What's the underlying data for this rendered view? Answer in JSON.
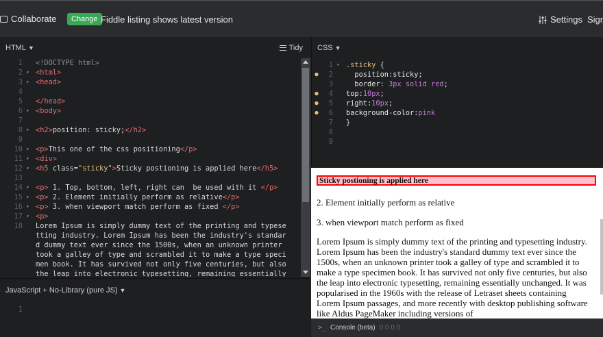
{
  "topbar": {
    "collaborate_label": "Collaborate",
    "change_label": "Change",
    "fiddle_message": "Fiddle listing shows latest version",
    "settings_label": "Settings",
    "sign_label": "Sign"
  },
  "html_panel": {
    "title": "HTML",
    "tidy_label": "Tidy",
    "lines": [
      {
        "n": "1",
        "fold": "",
        "segs": [
          [
            "comment",
            "<!DOCTYPE html>"
          ]
        ]
      },
      {
        "n": "2",
        "fold": "▾",
        "segs": [
          [
            "tag",
            "<html>"
          ]
        ]
      },
      {
        "n": "3",
        "fold": "▾",
        "segs": [
          [
            "tag",
            "<head>"
          ]
        ]
      },
      {
        "n": "4",
        "fold": "",
        "segs": []
      },
      {
        "n": "5",
        "fold": "",
        "segs": [
          [
            "tag",
            "</head>"
          ]
        ]
      },
      {
        "n": "6",
        "fold": "▾",
        "segs": [
          [
            "tag",
            "<body>"
          ]
        ]
      },
      {
        "n": "7",
        "fold": "",
        "segs": []
      },
      {
        "n": "8",
        "fold": "▾",
        "segs": [
          [
            "tag",
            "<h2>"
          ],
          [
            "txt",
            "position: sticky;"
          ],
          [
            "tag",
            "</h2>"
          ]
        ]
      },
      {
        "n": "9",
        "fold": "",
        "segs": []
      },
      {
        "n": "10",
        "fold": "▾",
        "segs": [
          [
            "tag",
            "<p>"
          ],
          [
            "txt",
            "This one of the css positioning"
          ],
          [
            "tag",
            "</p>"
          ]
        ]
      },
      {
        "n": "11",
        "fold": "▾",
        "segs": [
          [
            "tag",
            "<div>"
          ]
        ]
      },
      {
        "n": "12",
        "fold": "▾",
        "segs": [
          [
            "tag",
            "<h5 "
          ],
          [
            "attr",
            "class="
          ],
          [
            "str",
            "\"sticky\""
          ],
          [
            "tag",
            ">"
          ],
          [
            "txt",
            "Sticky postioning is applied here"
          ],
          [
            "tag",
            "</h5>"
          ]
        ]
      },
      {
        "n": "13",
        "fold": "",
        "segs": []
      },
      {
        "n": "14",
        "fold": "▾",
        "segs": [
          [
            "tag",
            "<p>"
          ],
          [
            "txt",
            " 1. Top, bottom, left, right can  be used with it "
          ],
          [
            "tag",
            "</p>"
          ]
        ]
      },
      {
        "n": "15",
        "fold": "▾",
        "segs": [
          [
            "tag",
            "<p>"
          ],
          [
            "txt",
            " 2. Element initially perform as relative"
          ],
          [
            "tag",
            "</p>"
          ]
        ]
      },
      {
        "n": "16",
        "fold": "▾",
        "segs": [
          [
            "tag",
            "<p>"
          ],
          [
            "txt",
            " 3. when viewport match perform as fixed "
          ],
          [
            "tag",
            "</p>"
          ]
        ]
      },
      {
        "n": "17",
        "fold": "▾",
        "segs": [
          [
            "tag",
            "<p>"
          ]
        ]
      },
      {
        "n": "18",
        "fold": "",
        "segs": [
          [
            "txt",
            "Lorem Ipsum is simply dummy text of the printing and typese"
          ]
        ]
      },
      {
        "n": "",
        "fold": "",
        "segs": [
          [
            "txt",
            "tting industry. Lorem Ipsum has been the industry's standar"
          ]
        ]
      },
      {
        "n": "",
        "fold": "",
        "segs": [
          [
            "txt",
            "d dummy text ever since the 1500s, when an unknown printer"
          ]
        ]
      },
      {
        "n": "",
        "fold": "",
        "segs": [
          [
            "txt",
            "took a galley of type and scrambled it to make a type speci"
          ]
        ]
      },
      {
        "n": "",
        "fold": "",
        "segs": [
          [
            "txt",
            "men book. It has survived not only five centuries, but also"
          ]
        ]
      },
      {
        "n": "",
        "fold": "",
        "segs": [
          [
            "txt",
            "the leap into electronic typesetting, remaining essentially"
          ]
        ]
      }
    ]
  },
  "css_panel": {
    "title": "CSS",
    "lines": [
      {
        "n": "1",
        "fold": "▾",
        "dot": false,
        "segs": [
          [
            "sel",
            ".sticky "
          ],
          [
            "txt",
            "{"
          ]
        ]
      },
      {
        "n": "2",
        "fold": "",
        "dot": true,
        "segs": [
          [
            "txt",
            "  "
          ],
          [
            "prop",
            "position:sticky;"
          ]
        ]
      },
      {
        "n": "3",
        "fold": "",
        "dot": false,
        "segs": [
          [
            "txt",
            "  "
          ],
          [
            "prop",
            "border: "
          ],
          [
            "num",
            "3px"
          ],
          [
            "val",
            " solid red"
          ],
          [
            "txt",
            ";"
          ]
        ]
      },
      {
        "n": "4",
        "fold": "",
        "dot": true,
        "segs": [
          [
            "prop",
            "top:"
          ],
          [
            "num",
            "10px"
          ],
          [
            "txt",
            ";"
          ]
        ]
      },
      {
        "n": "5",
        "fold": "",
        "dot": true,
        "segs": [
          [
            "prop",
            "right:"
          ],
          [
            "num",
            "10px"
          ],
          [
            "txt",
            ";"
          ]
        ]
      },
      {
        "n": "6",
        "fold": "",
        "dot": true,
        "segs": [
          [
            "prop",
            "background-color:"
          ],
          [
            "val",
            "pink"
          ]
        ]
      },
      {
        "n": "7",
        "fold": "",
        "dot": false,
        "segs": [
          [
            "txt",
            "}"
          ]
        ]
      },
      {
        "n": "8",
        "fold": "",
        "dot": false,
        "segs": []
      },
      {
        "n": "9",
        "fold": "",
        "dot": false,
        "segs": []
      }
    ]
  },
  "js_panel": {
    "title": "JavaScript + No-Library (pure JS)",
    "lines": [
      {
        "n": "1"
      }
    ]
  },
  "result": {
    "sticky_heading": "Sticky postioning is applied here",
    "p2": "2. Element initially perform as relative",
    "p3": "3. when viewport match perform as fixed",
    "lorem": "Lorem Ipsum is simply dummy text of the printing and typesetting industry. Lorem Ipsum has been the industry's standard dummy text ever since the 1500s, when an unknown printer took a galley of type and scrambled it to make a type specimen book. It has survived not only five centuries, but also the leap into electronic typesetting, remaining essentially unchanged. It was popularised in the 1960s with the release of Letraset sheets containing Lorem Ipsum passages, and more recently with desktop publishing software like Aldus PageMaker including versions of"
  },
  "console": {
    "label": "Console (beta)",
    "counts": "0  0  0  0"
  }
}
